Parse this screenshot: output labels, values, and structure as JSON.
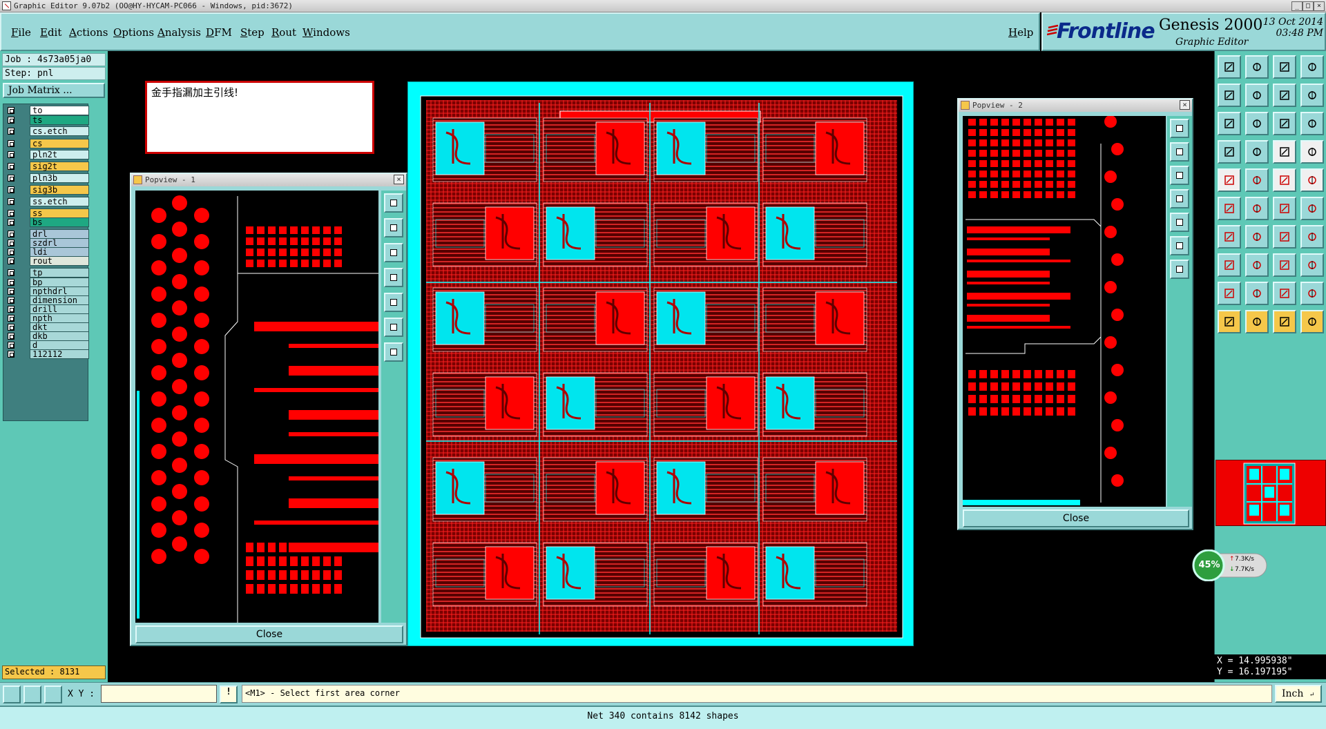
{
  "window": {
    "title": "Graphic Editor 9.07b2 (OO@HY-HYCAM-PC066 - Windows, pid:3672)"
  },
  "menu": {
    "items": [
      "File",
      "Edit",
      "Actions",
      "Options",
      "Analysis",
      "DFM",
      "Step",
      "Rout",
      "Windows"
    ],
    "help": "Help"
  },
  "brand": {
    "logo": "Frontline",
    "product": "Genesis 2000",
    "subtitle": "Graphic Editor",
    "date": "13 Oct 2014",
    "time": "03:48 PM"
  },
  "job": {
    "job_label": "Job : 4s73a05ja0",
    "step_label": "Step: pnl",
    "job_matrix": "Job Matrix ..."
  },
  "layers": [
    {
      "name": "to",
      "color": "#ffffff"
    },
    {
      "name": "ts",
      "color": "#1ea882"
    },
    {
      "name": "cs.etch",
      "color": "#cdeeee"
    },
    {
      "name": "cs",
      "color": "#f5c74a"
    },
    {
      "name": "pln2t",
      "color": "#cdeeee"
    },
    {
      "name": "sig2t",
      "color": "#f5c74a"
    },
    {
      "name": "pln3b",
      "color": "#cdeeee"
    },
    {
      "name": "sig3b",
      "color": "#f5c74a"
    },
    {
      "name": "ss.etch",
      "color": "#cdeeee"
    },
    {
      "name": "ss",
      "color": "#f5c74a"
    },
    {
      "name": "bs",
      "color": "#1ea882"
    },
    {
      "name": "drl",
      "color": "#a9c6d8"
    },
    {
      "name": "szdrl",
      "color": "#a9c6d8"
    },
    {
      "name": "ldi",
      "color": "#a9c6d8"
    },
    {
      "name": "rout",
      "color": "#dfe7dc"
    },
    {
      "name": "tp",
      "color": "#a8d8d8"
    },
    {
      "name": "bp",
      "color": "#a8d8d8"
    },
    {
      "name": "npthdrl",
      "color": "#a8d8d8"
    },
    {
      "name": "dimension",
      "color": "#a8d8d8"
    },
    {
      "name": "drill",
      "color": "#a8d8d8"
    },
    {
      "name": "npth",
      "color": "#a8d8d8"
    },
    {
      "name": "dkt",
      "color": "#a8d8d8"
    },
    {
      "name": "dkb",
      "color": "#a8d8d8"
    },
    {
      "name": "d",
      "color": "#a8d8d8"
    },
    {
      "name": "112112",
      "color": "#a8d8d8"
    }
  ],
  "selected": "Selected : 8131",
  "message_note": "金手指漏加主引线!",
  "popview1": {
    "title": "Popview - 1",
    "close": "Close"
  },
  "popview2": {
    "title": "Popview - 2",
    "close": "Close"
  },
  "network": {
    "percent": "45%",
    "up": "7.3K/s",
    "down": "7.7K/s"
  },
  "coords": {
    "x": "X = 14.995938\"",
    "y": "Y = 16.197195\""
  },
  "bottom": {
    "xy_label": "X Y :",
    "xy_value": "",
    "prompt": "<M1> - Select first area corner",
    "units": "Inch"
  },
  "status": "Net 340 contains 8142 shapes",
  "colors": {
    "panel": "#9ad8d8",
    "accent": "#5ec8b6",
    "copper": "#ff0000",
    "board": "#00ffff"
  }
}
